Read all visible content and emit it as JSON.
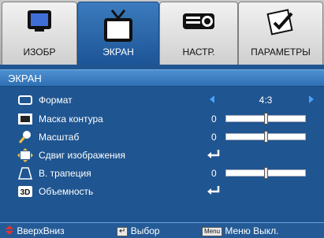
{
  "tabs": [
    {
      "label": "ИЗОБР",
      "icon": "monitor-icon",
      "active": false
    },
    {
      "label": "ЭКРАН",
      "icon": "tv-icon",
      "active": true
    },
    {
      "label": "НАСТР.",
      "icon": "projector-icon",
      "active": false
    },
    {
      "label": "ПАРАМЕТРЫ",
      "icon": "settings-document-icon",
      "active": false
    }
  ],
  "section": {
    "title": "ЭКРАН"
  },
  "rows": [
    {
      "label": "Формат",
      "icon": "aspect-ratio-icon",
      "value": "4:3",
      "control": "selector"
    },
    {
      "label": "Маска контура",
      "icon": "edge-mask-icon",
      "value": "0",
      "control": "slider",
      "level": 0.5
    },
    {
      "label": "Масштаб",
      "icon": "zoom-icon",
      "value": "0",
      "control": "slider",
      "level": 0.5
    },
    {
      "label": "Сдвиг изображения",
      "icon": "image-shift-icon",
      "value": "",
      "control": "enter"
    },
    {
      "label": "В. трапеция",
      "icon": "keystone-icon",
      "value": "0",
      "control": "slider",
      "level": 0.5
    },
    {
      "label": "Объемность",
      "icon": "3d-icon",
      "value": "",
      "control": "enter"
    }
  ],
  "footer": {
    "nav_label": "ВверхВниз",
    "select_label": "Выбор",
    "menu_key": "Menu",
    "exit_label": "Меню Выкл."
  },
  "colors": {
    "panel": "#1f5590",
    "active_tab": "#2f6fb3",
    "highlight": "#4d91d2"
  }
}
